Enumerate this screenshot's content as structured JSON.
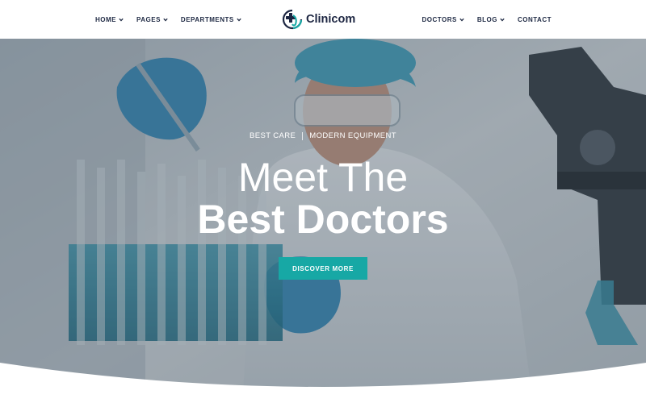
{
  "header": {
    "nav_left": [
      {
        "label": "HOME",
        "has_dropdown": true
      },
      {
        "label": "PAGES",
        "has_dropdown": true
      },
      {
        "label": "DEPARTMENTS",
        "has_dropdown": true
      }
    ],
    "nav_right": [
      {
        "label": "DOCTORS",
        "has_dropdown": true
      },
      {
        "label": "BLOG",
        "has_dropdown": true
      },
      {
        "label": "CONTACT",
        "has_dropdown": false
      }
    ],
    "logo": {
      "text": "Clinicom",
      "icon": "medical-cross-logo-icon"
    }
  },
  "hero": {
    "tagline_left": "BEST CARE",
    "tagline_right": "MODERN EQUIPMENT",
    "title_line1": "Meet The",
    "title_line2": "Best Doctors",
    "cta_label": "DISCOVER MORE",
    "background": "scientist-in-lab-photo"
  },
  "colors": {
    "accent": "#17a8a5",
    "nav_text": "#1f2a44",
    "logo_dark": "#1c2541",
    "hero_text": "#ffffff"
  }
}
